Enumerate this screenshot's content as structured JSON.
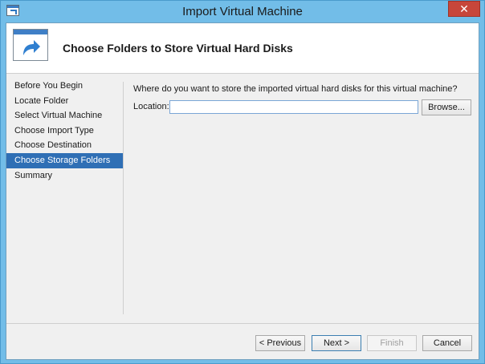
{
  "window": {
    "title": "Import Virtual Machine",
    "close_glyph": "✕"
  },
  "header": {
    "title": "Choose Folders to Store Virtual Hard Disks",
    "icon": "import-arrow-icon"
  },
  "nav": {
    "items": [
      {
        "label": "Before You Begin",
        "active": false
      },
      {
        "label": "Locate Folder",
        "active": false
      },
      {
        "label": "Select Virtual Machine",
        "active": false
      },
      {
        "label": "Choose Import Type",
        "active": false
      },
      {
        "label": "Choose Destination",
        "active": false
      },
      {
        "label": "Choose Storage Folders",
        "active": true
      },
      {
        "label": "Summary",
        "active": false
      }
    ]
  },
  "main": {
    "question": "Where do you want to store the imported virtual hard disks for this virtual machine?",
    "location_label": "Location:",
    "location_value": "",
    "browse_label": "Browse..."
  },
  "footer": {
    "previous_label": "< Previous",
    "next_label": "Next >",
    "finish_label": "Finish",
    "cancel_label": "Cancel"
  },
  "colors": {
    "accent": "#2f6fb5",
    "title_bar": "#72bde8",
    "close": "#c7463a"
  }
}
